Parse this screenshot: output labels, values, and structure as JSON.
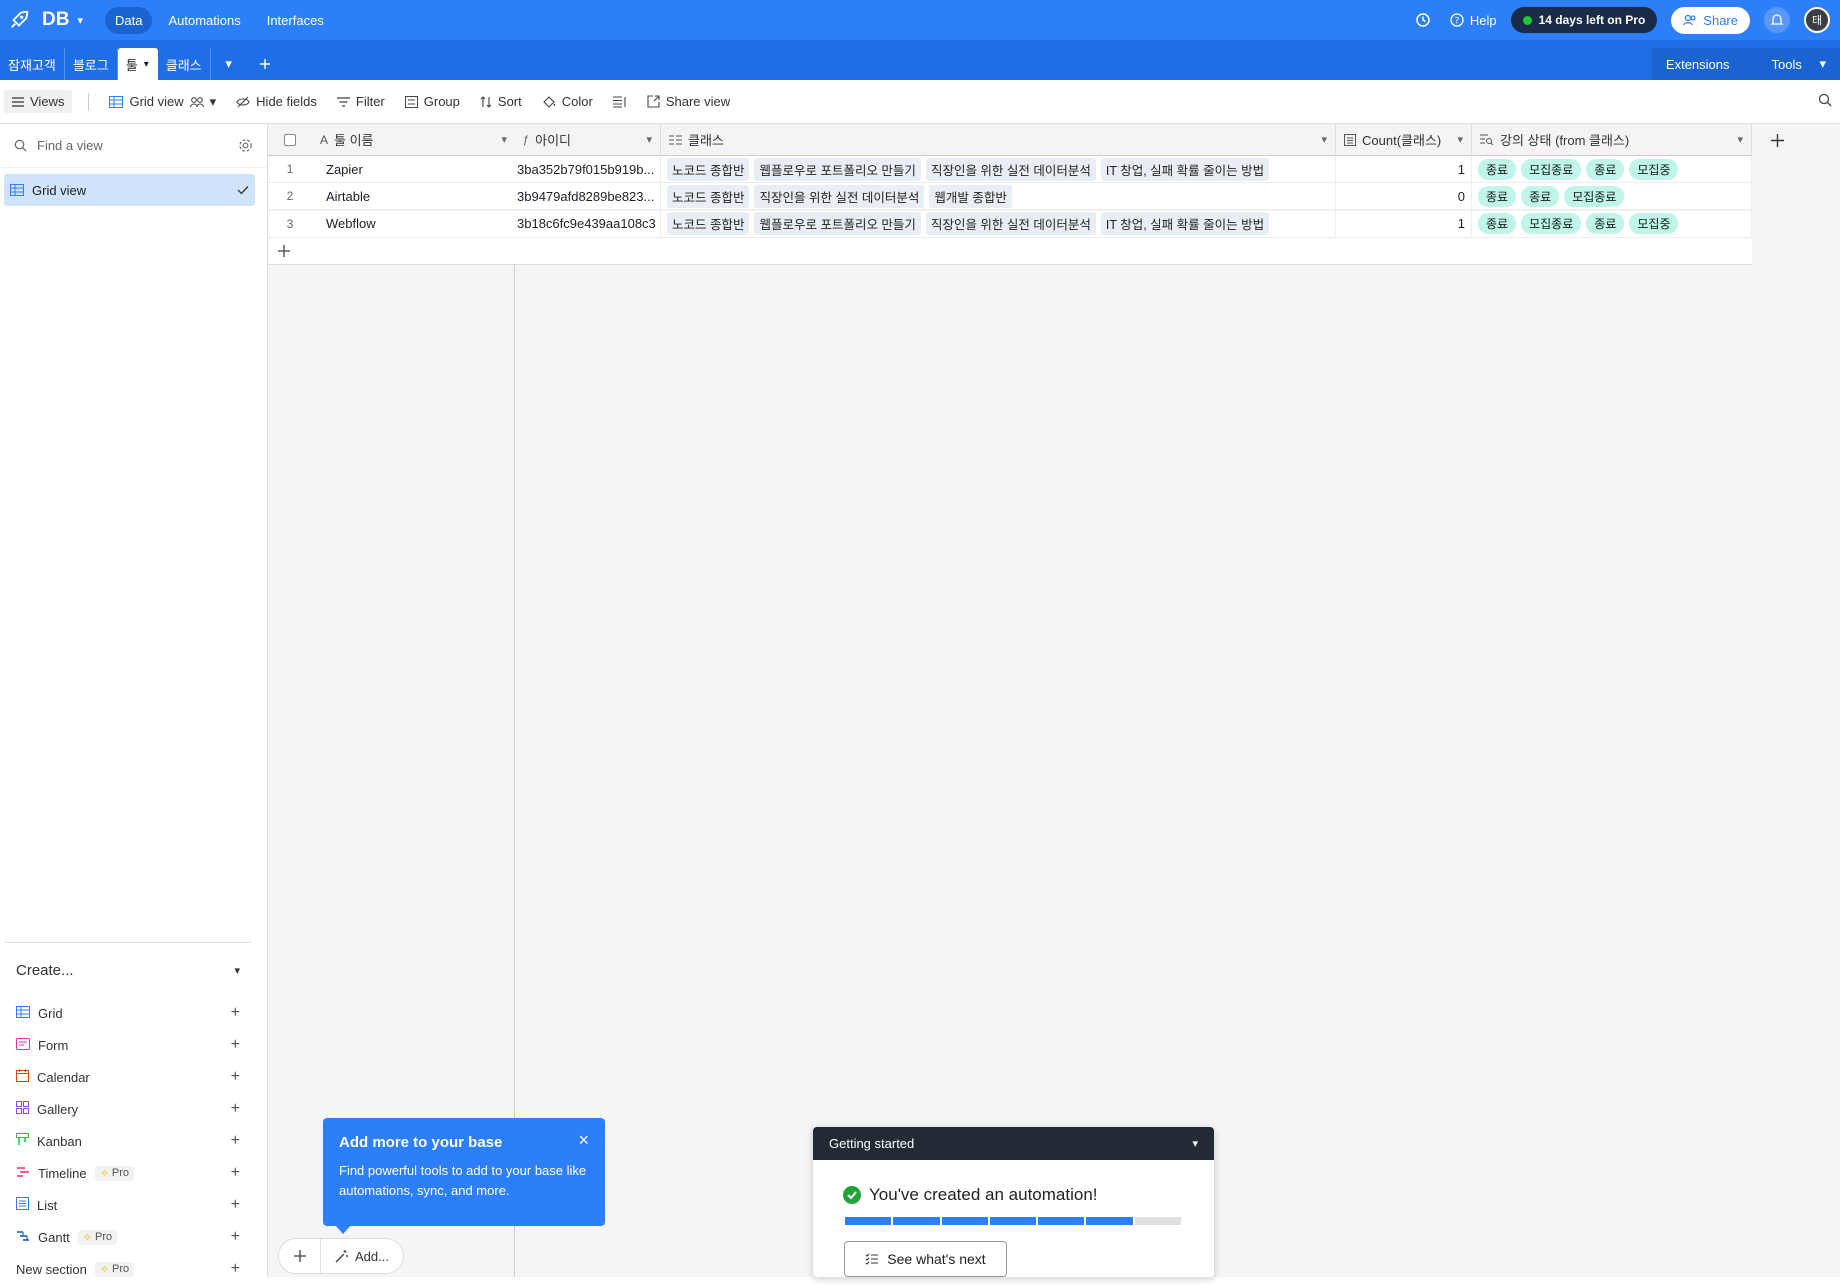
{
  "topbar": {
    "base_name": "DB",
    "nav": [
      "Data",
      "Automations",
      "Interfaces"
    ],
    "help": "Help",
    "trial": "14 days left on Pro",
    "share": "Share",
    "avatar": "태"
  },
  "tabs": {
    "items": [
      "잠재고객",
      "블로그",
      "툴",
      "클래스"
    ],
    "active_index": 2,
    "extensions": "Extensions",
    "tools": "Tools"
  },
  "toolbar": {
    "views": "Views",
    "view_name": "Grid view",
    "hide_fields": "Hide fields",
    "filter": "Filter",
    "group": "Group",
    "sort": "Sort",
    "color": "Color",
    "share_view": "Share view"
  },
  "sidebar": {
    "find_placeholder": "Find a view",
    "views": [
      "Grid view"
    ],
    "create_label": "Create...",
    "create_items": [
      {
        "label": "Grid",
        "pro": "",
        "color": "#2d7ff9"
      },
      {
        "label": "Form",
        "pro": "",
        "color": "#e929ba"
      },
      {
        "label": "Calendar",
        "pro": "",
        "color": "#d54401"
      },
      {
        "label": "Gallery",
        "pro": "",
        "color": "#8b46ff"
      },
      {
        "label": "Kanban",
        "pro": "",
        "color": "#20c933"
      },
      {
        "label": "Timeline",
        "pro": "Pro",
        "color": "#f82b60"
      },
      {
        "label": "List",
        "pro": "",
        "color": "#2d7ff9"
      },
      {
        "label": "Gantt",
        "pro": "Pro",
        "color": "#0d52ac"
      },
      {
        "label": "New section",
        "pro": "Pro",
        "color": ""
      }
    ]
  },
  "grid": {
    "columns": {
      "name": "툴 이름",
      "id": "아이디",
      "class": "클래스",
      "count": "Count(클래스)",
      "status": "강의 상태 (from 클래스)"
    },
    "rows": [
      {
        "num": "1",
        "name": "Zapier",
        "id": "3ba352b79f015b919b...",
        "classes": [
          "노코드 종합반",
          "웹플로우로 포트폴리오 만들기",
          "직장인을 위한 실전 데이터분석",
          "IT 창업, 실패 확률 줄이는 방법"
        ],
        "count": "1",
        "statuses": [
          "종료",
          "모집종료",
          "종료",
          "모집중"
        ]
      },
      {
        "num": "2",
        "name": "Airtable",
        "id": "3b9479afd8289be823...",
        "classes": [
          "노코드 종합반",
          "직장인을 위한 실전 데이터분석",
          "웹개발 종합반"
        ],
        "count": "0",
        "statuses": [
          "종료",
          "종료",
          "모집종료"
        ]
      },
      {
        "num": "3",
        "name": "Webflow",
        "id": "3b18c6fc9e439aa108c3",
        "classes": [
          "노코드 종합반",
          "웹플로우로 포트폴리오 만들기",
          "직장인을 위한 실전 데이터분석",
          "IT 창업, 실패 확률 줄이는 방법"
        ],
        "count": "1",
        "statuses": [
          "종료",
          "모집종료",
          "종료",
          "모집중"
        ]
      }
    ]
  },
  "bottom": {
    "add_label": "Add..."
  },
  "popover": {
    "title": "Add more to your base",
    "body": "Find powerful tools to add to your base like automations, sync, and more."
  },
  "getting_started": {
    "title": "Getting started",
    "message": "You've created an automation!",
    "progress_done": 6,
    "progress_total": 7,
    "button": "See what's next"
  }
}
